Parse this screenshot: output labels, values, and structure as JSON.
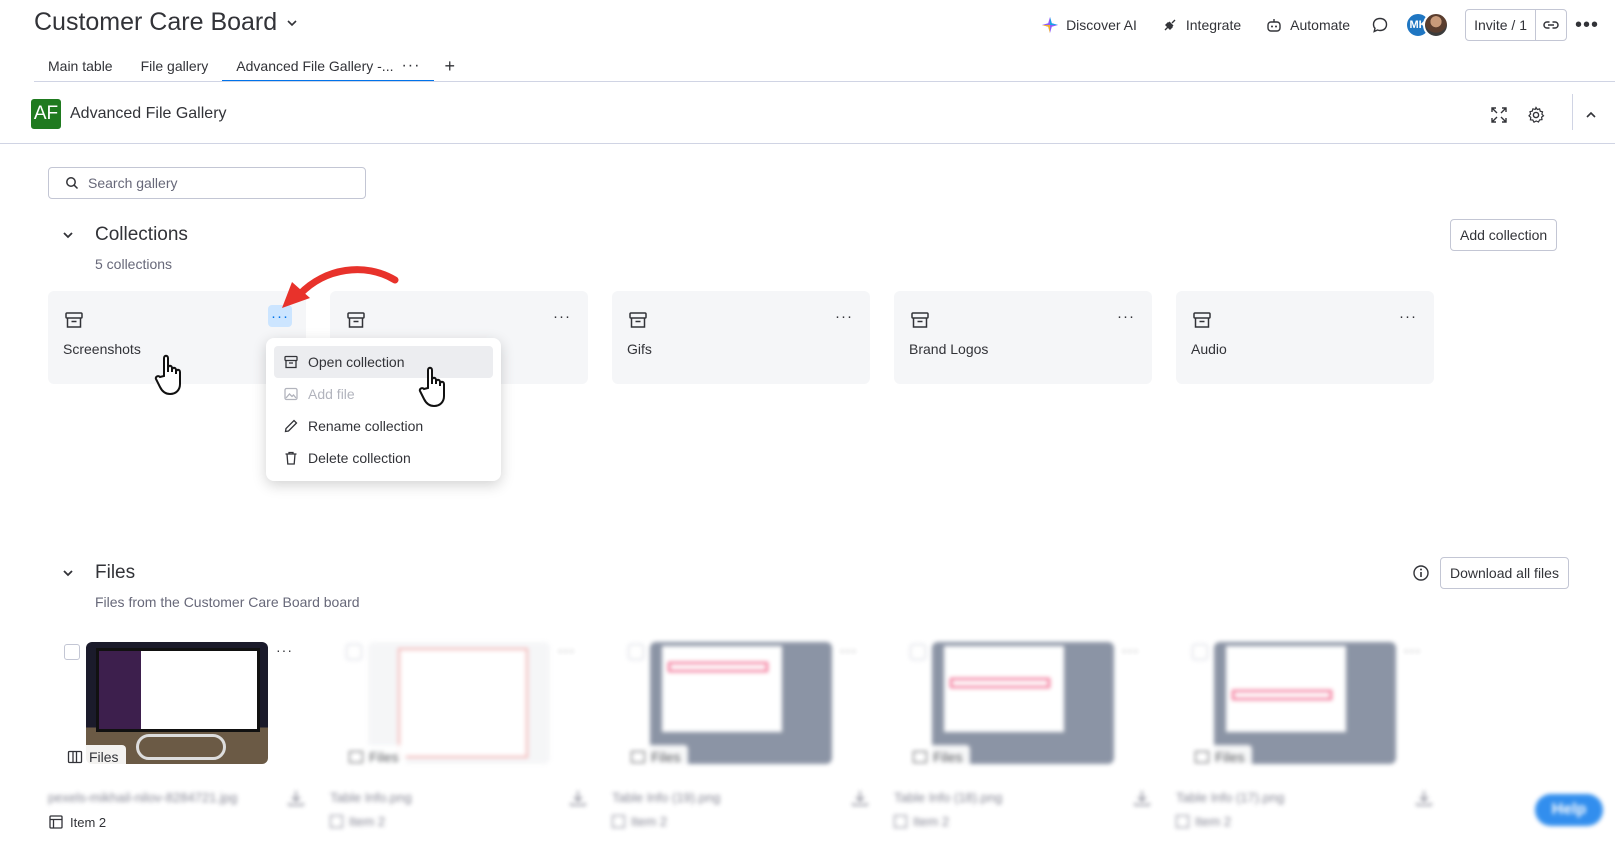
{
  "header": {
    "board_title": "Customer Care Board",
    "discover_ai": "Discover AI",
    "integrate": "Integrate",
    "automate": "Automate",
    "avatar_initials": "MK",
    "invite": "Invite / 1"
  },
  "tabs": [
    {
      "label": "Main table"
    },
    {
      "label": "File gallery"
    },
    {
      "label": "Advanced File Gallery -..."
    }
  ],
  "app": {
    "logo": "AF",
    "name": "Advanced File Gallery"
  },
  "search": {
    "placeholder": "Search gallery"
  },
  "collections": {
    "title": "Collections",
    "count": "5 collections",
    "add_button": "Add collection",
    "items": [
      {
        "name": "Screenshots"
      },
      {
        "name": ""
      },
      {
        "name": "Gifs"
      },
      {
        "name": "Brand Logos"
      },
      {
        "name": "Audio"
      }
    ]
  },
  "menu": {
    "items": [
      {
        "label": "Open collection",
        "icon": "archive-icon",
        "state": "hover"
      },
      {
        "label": "Add file",
        "icon": "image-icon",
        "state": "disabled"
      },
      {
        "label": "Rename collection",
        "icon": "pencil-icon",
        "state": "normal"
      },
      {
        "label": "Delete collection",
        "icon": "trash-icon",
        "state": "normal"
      }
    ]
  },
  "files": {
    "title": "Files",
    "subtitle": "Files from the Customer Care Board board",
    "download_all": "Download all files",
    "items": [
      {
        "tag": "Files",
        "name": "pexels-mikhail-nilov-8284721.jpg",
        "item": "Item 2"
      },
      {
        "tag": "Files",
        "name": "Table Info.png",
        "item": "Item 2"
      },
      {
        "tag": "Files",
        "name": "Table Info (19).png",
        "item": "Item 2"
      },
      {
        "tag": "Files",
        "name": "Table Info (18).png",
        "item": "Item 2"
      },
      {
        "tag": "Files",
        "name": "Table Info (17).png",
        "item": "Item 2"
      }
    ]
  },
  "help": "Help",
  "colors": {
    "accent": "#0073ea",
    "accent_light": "#cce5ff",
    "logo_green": "#1f7a1f",
    "arrow_red": "#e8322b"
  }
}
